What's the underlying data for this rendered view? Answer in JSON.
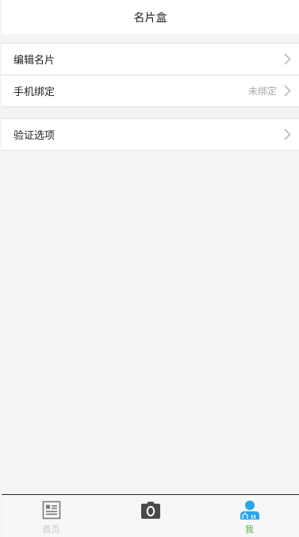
{
  "header": {
    "title": "名片盒"
  },
  "groups": [
    {
      "items": [
        {
          "label": "编辑名片",
          "value": ""
        },
        {
          "label": "手机绑定",
          "value": "未绑定"
        }
      ]
    },
    {
      "items": [
        {
          "label": "验证选项",
          "value": ""
        }
      ]
    }
  ],
  "tabbar": {
    "tabs": [
      {
        "label": "首页",
        "icon": "card-list-icon",
        "active": false
      },
      {
        "label": "",
        "icon": "camera-icon",
        "active": false
      },
      {
        "label": "我",
        "icon": "person-icon",
        "active": true
      }
    ]
  },
  "colors": {
    "background": "#f4f4f4",
    "active_tab_icon": "#29a6ea",
    "active_tab_label": "#4caf50",
    "inactive": "#8a8a8a",
    "value_text": "#a8a8a8"
  }
}
